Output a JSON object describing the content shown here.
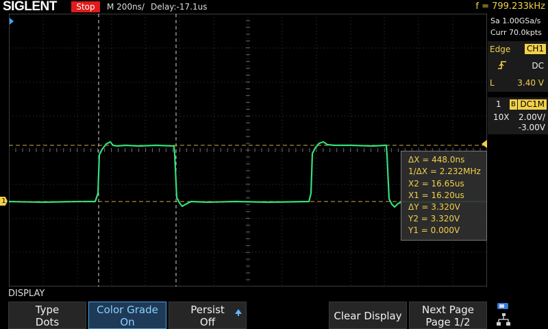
{
  "header": {
    "brand": "SIGLENT",
    "run_state": "Stop",
    "timebase": "M 200ns/",
    "delay": "Delay:-17.1us",
    "frequency": "f = 799.233kHz"
  },
  "acquisition": {
    "sample_rate": "Sa 1.00GSa/s",
    "memory": "Curr 70.0kpts"
  },
  "trigger": {
    "mode": "Edge",
    "source": "CH1",
    "coupling": "DC",
    "slope_icon": "rising-edge-icon",
    "level_label": "L",
    "level": "3.40 V"
  },
  "channel": {
    "number": "1",
    "bw_icon": "B",
    "coupling": "DC1M",
    "probe": "10X",
    "scale": "2.00V/",
    "offset": "-3.00V",
    "marker": "1"
  },
  "cursors": {
    "dx": "ΔX = 448.0ns",
    "inv_dx": "1/ΔX = 2.232MHz",
    "x2": "X2 = 16.65us",
    "x1": "X1 = 16.20us",
    "dy": "ΔY = 3.320V",
    "y2": "Y2 = 3.320V",
    "y1": "Y1 = 0.000V"
  },
  "menu": {
    "title": "DISPLAY",
    "softkeys": [
      {
        "label": "Type",
        "value": "Dots"
      },
      {
        "label": "Color Grade",
        "value": "On"
      },
      {
        "label": "Persist",
        "value": "Off"
      },
      {
        "label": "",
        "value": ""
      },
      {
        "label": "Clear Display",
        "value": ""
      },
      {
        "label": "Next Page",
        "value": "Page 1/2"
      }
    ]
  },
  "colors": {
    "trace": "#34e07a",
    "accent": "#f2d14a",
    "active": "#4aa3e8",
    "stop": "#e01b1b"
  }
}
